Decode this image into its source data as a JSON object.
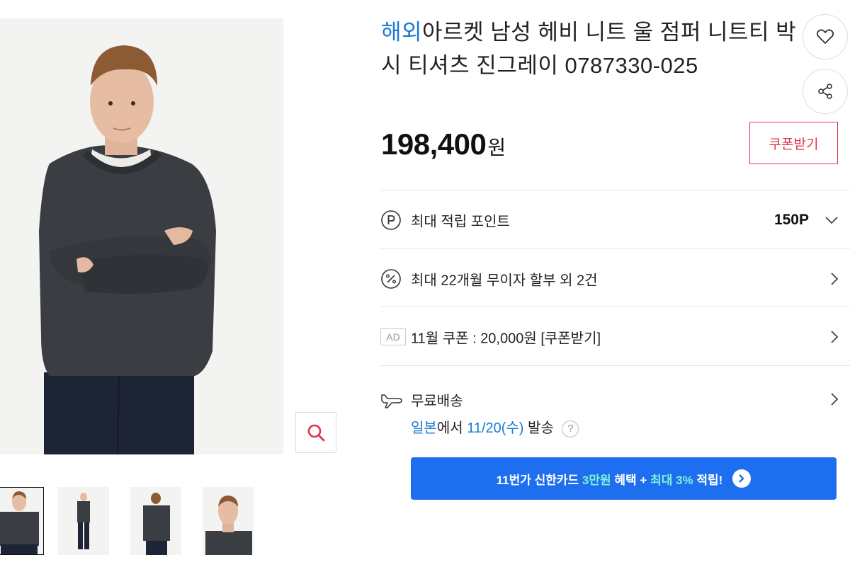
{
  "product": {
    "overseas_tag": "해외",
    "title": "아르켓 남성 헤비 니트 울 점퍼 니트티 박시 티셔츠 진그레이 0787330-025",
    "price": "198,400",
    "price_unit": "원",
    "coupon_label": "쿠폰받기"
  },
  "benefits": {
    "points_label": "최대 적립 포인트",
    "points_value": "150P",
    "installment_label": "최대 22개월 무이자 할부 외 2건",
    "ad_badge": "AD",
    "coupon_row_label": "11월 쿠폰 : 20,000원 [쿠폰받기]"
  },
  "shipping": {
    "title": "무료배송",
    "origin": "일본",
    "origin_suffix": "에서",
    "date": "11/20(수)",
    "status": "발송",
    "help": "?"
  },
  "banner": {
    "prefix": "11번가 신한카드",
    "highlight_amount": "3만원",
    "middle": "혜택 +",
    "highlight_rate": "최대 3%",
    "suffix": "적립!"
  },
  "icons": {
    "wishlist": "heart-icon",
    "share": "share-icon",
    "zoom": "search-icon",
    "points": "point-p-icon",
    "installment": "percent-icon",
    "shipping": "airplane-icon",
    "chevron_down": "chevron-down-icon",
    "chevron_right": "chevron-right-icon"
  },
  "colors": {
    "brand_blue": "#1e6ff0",
    "overseas_blue": "#1a7ad6",
    "coupon_red": "#e0344c",
    "banner_highlight": "#7ef3d8",
    "sweater": "#3a3d42",
    "trousers": "#1d2436"
  }
}
